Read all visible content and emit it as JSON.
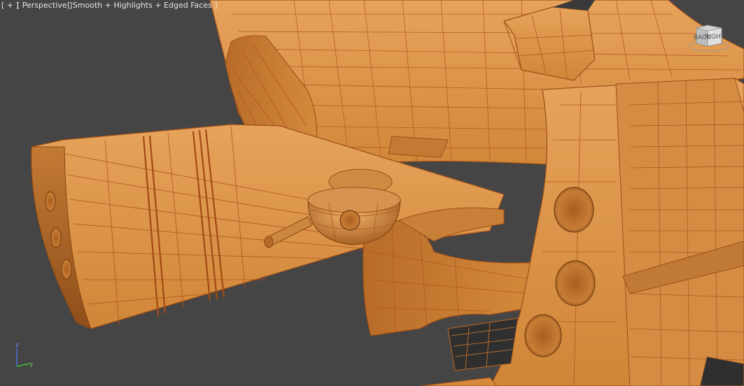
{
  "viewport": {
    "labels": {
      "menu": "[ + ]",
      "view": "[ Perspective ]",
      "shading": "[ Smooth + Highlights + Edged Faces ]"
    },
    "viewcube": {
      "face_left": "BACK",
      "face_right": "RIGHT"
    },
    "axis": {
      "z": "z",
      "y": "y"
    },
    "colors": {
      "background": "#454545",
      "model": "#d68a3e",
      "wire": "#b4561c",
      "axis_z": "#4a6ed6",
      "axis_y": "#3fbf3f"
    }
  }
}
